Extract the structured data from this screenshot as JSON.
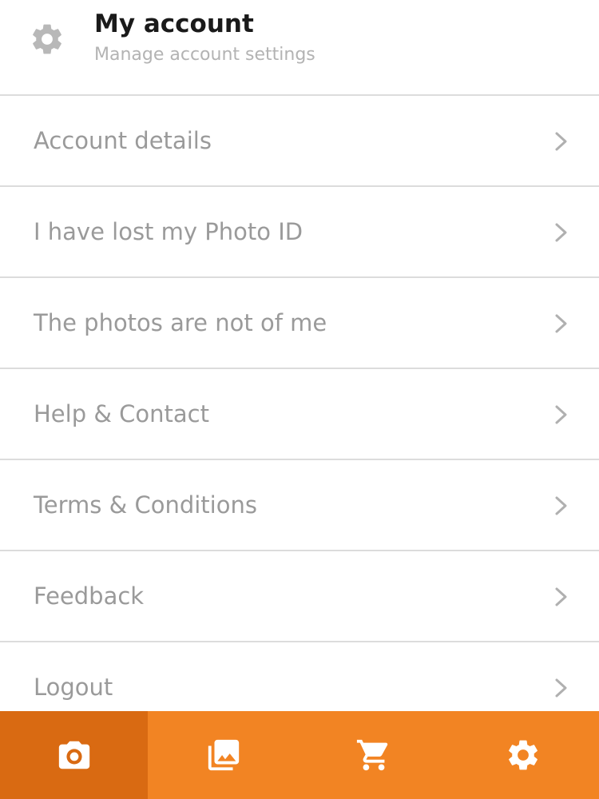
{
  "header": {
    "icon": "gear-icon",
    "title": "My account",
    "subtitle": "Manage account settings"
  },
  "menu": {
    "items": [
      {
        "label": "Account details",
        "icon": "chevron-right-icon"
      },
      {
        "label": "I have lost my Photo ID",
        "icon": "chevron-right-icon"
      },
      {
        "label": "The photos are not of me",
        "icon": "chevron-right-icon"
      },
      {
        "label": "Help & Contact",
        "icon": "chevron-right-icon"
      },
      {
        "label": "Terms & Conditions",
        "icon": "chevron-right-icon"
      },
      {
        "label": "Feedback",
        "icon": "chevron-right-icon"
      },
      {
        "label": "Logout",
        "icon": "chevron-right-icon"
      }
    ]
  },
  "tabbar": {
    "tabs": [
      {
        "icon": "camera-icon",
        "active": true
      },
      {
        "icon": "photo-library-icon",
        "active": false
      },
      {
        "icon": "cart-icon",
        "active": false
      },
      {
        "icon": "settings-gear-icon",
        "active": false
      }
    ]
  },
  "colors": {
    "accent": "#f28423",
    "accent_active": "#d96a12",
    "label_gray": "#9a9a9a",
    "divider": "#dcdcdc"
  }
}
